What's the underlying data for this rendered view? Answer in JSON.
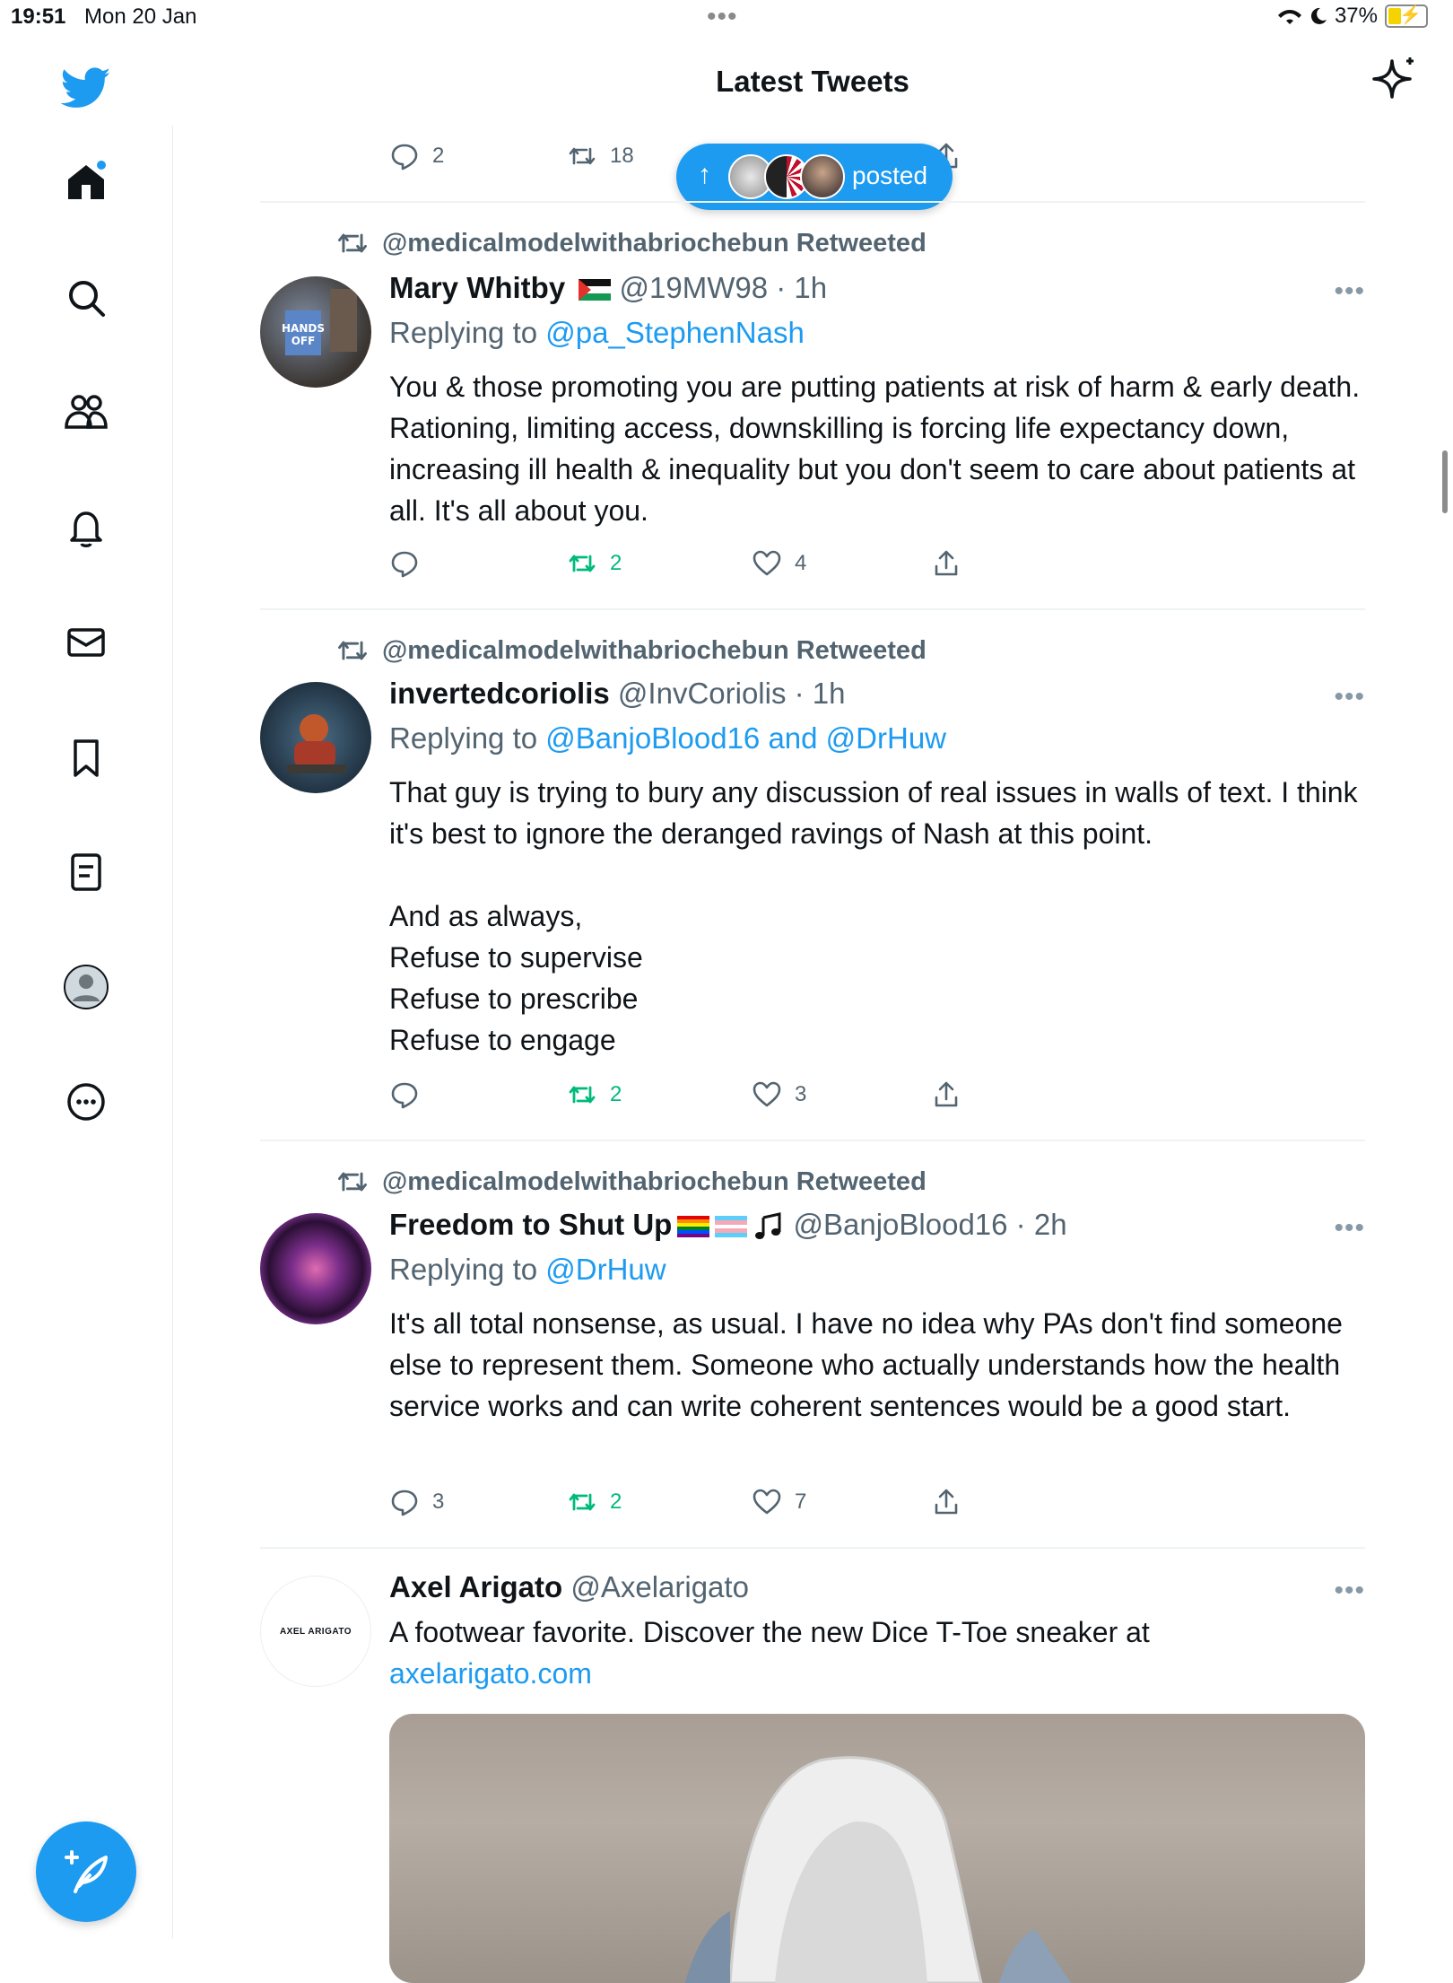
{
  "status_bar": {
    "time": "19:51",
    "date": "Mon 20 Jan",
    "battery": "37%",
    "battery_level": 0.37
  },
  "header": {
    "title": "Latest Tweets"
  },
  "new_posts_pill": {
    "label": "posted"
  },
  "prev_tweet_actions": {
    "replies": "2",
    "retweets": "18"
  },
  "tweets": [
    {
      "retweeted_by": "@medicalmodelwithabriochebun Retweeted",
      "name": "Mary Whitby",
      "handle_time": "@19MW98 · 1h",
      "replying_prefix": "Replying to ",
      "replying_to": "@pa_StephenNash",
      "text": "You & those promoting you are putting patients at risk of harm & early death. Rationing, limiting access, downskilling is forcing life expectancy down, increasing ill health & inequality but you don't seem to care about patients at all. It's all about you.",
      "replies": "",
      "retweets": "2",
      "likes": "4"
    },
    {
      "retweeted_by": "@medicalmodelwithabriochebun Retweeted",
      "name": "invertedcoriolis",
      "handle_time": "@InvCoriolis · 1h",
      "replying_prefix": "Replying to ",
      "replying_to": "@BanjoBlood16 and @DrHuw",
      "text": "That guy is trying to bury any discussion of real issues in walls of text. I think it's best to ignore the deranged ravings of Nash at this point.\n\nAnd as always,\nRefuse to supervise\nRefuse to prescribe\nRefuse to engage",
      "replies": "",
      "retweets": "2",
      "likes": "3"
    },
    {
      "retweeted_by": "@medicalmodelwithabriochebun Retweeted",
      "name": "Freedom to Shut Up",
      "handle_time": "@BanjoBlood16 · 2h",
      "replying_prefix": "Replying to ",
      "replying_to": "@DrHuw",
      "text": "It's all total nonsense, as usual. I have no idea why PAs don't find someone else to represent them. Someone who actually understands how the health service works and can write coherent sentences would be a good start.",
      "replies": "3",
      "retweets": "2",
      "likes": "7"
    }
  ],
  "promoted": {
    "name": "Axel Arigato",
    "handle": "@Axelarigato",
    "avatar_text": "AXEL ARIGATO",
    "text": "A footwear favorite. Discover the new Dice T-Toe sneaker at",
    "link": "axelarigato.com"
  },
  "colors": {
    "accent": "#1d9bf0",
    "retweet_green": "#00ba7c",
    "secondary_text": "#536471"
  }
}
